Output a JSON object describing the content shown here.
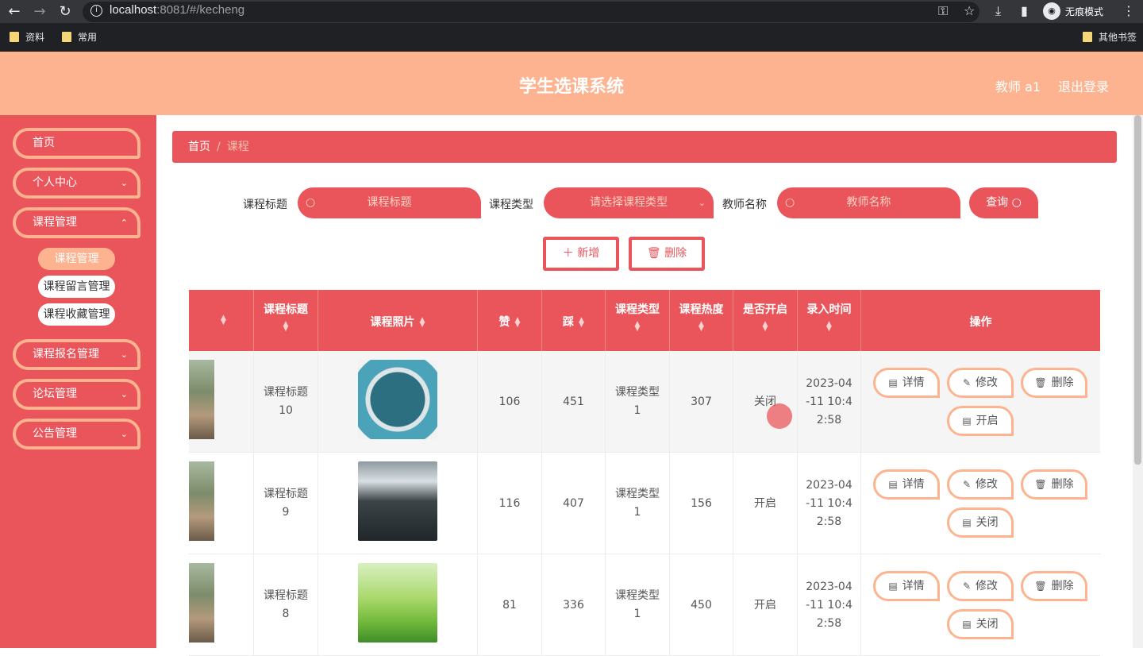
{
  "browser": {
    "url_host": "localhost",
    "url_rest": ":8081/#/kecheng",
    "incognito_label": "无痕模式",
    "bookmarks": [
      "资料",
      "常用"
    ],
    "other_bookmarks": "其他书签"
  },
  "header": {
    "title": "学生选课系统",
    "user": "教师 a1",
    "logout": "退出登录"
  },
  "sidebar": {
    "items": [
      {
        "label": "首页"
      },
      {
        "label": "个人中心"
      },
      {
        "label": "课程管理"
      },
      {
        "label": "课程报名管理"
      },
      {
        "label": "论坛管理"
      },
      {
        "label": "公告管理"
      }
    ],
    "submenu": [
      {
        "label": "课程管理",
        "active": true
      },
      {
        "label": "课程留言管理"
      },
      {
        "label": "课程收藏管理"
      }
    ]
  },
  "breadcrumb": {
    "home": "首页",
    "separator": "/",
    "current": "课程"
  },
  "filters": {
    "title_label": "课程标题",
    "title_placeholder": "课程标题",
    "type_label": "课程类型",
    "type_placeholder": "请选择课程类型",
    "teacher_label": "教师名称",
    "teacher_placeholder": "教师名称",
    "query_button": "查询"
  },
  "actions": {
    "add": "新增",
    "delete": "删除"
  },
  "table": {
    "headers": [
      "",
      "课程标题",
      "课程照片",
      "赞",
      "踩",
      "课程类型",
      "课程热度",
      "是否开启",
      "录入时间",
      "操作"
    ],
    "rows": [
      {
        "title": "课程标题10",
        "likes": "106",
        "dislikes": "451",
        "type": "课程类型1",
        "heat": "307",
        "open": "关闭",
        "time": "2023-04-11 10:42:58",
        "toggle": "开启"
      },
      {
        "title": "课程标题9",
        "likes": "116",
        "dislikes": "407",
        "type": "课程类型1",
        "heat": "156",
        "open": "开启",
        "time": "2023-04-11 10:42:58",
        "toggle": "关闭"
      },
      {
        "title": "课程标题8",
        "likes": "81",
        "dislikes": "336",
        "type": "课程类型1",
        "heat": "450",
        "open": "开启",
        "time": "2023-04-11 10:42:58",
        "toggle": "关闭"
      }
    ],
    "op_labels": {
      "detail": "详情",
      "edit": "修改",
      "delete": "删除"
    }
  },
  "colors": {
    "primary": "#e9555a",
    "accent": "#fdb38f"
  }
}
